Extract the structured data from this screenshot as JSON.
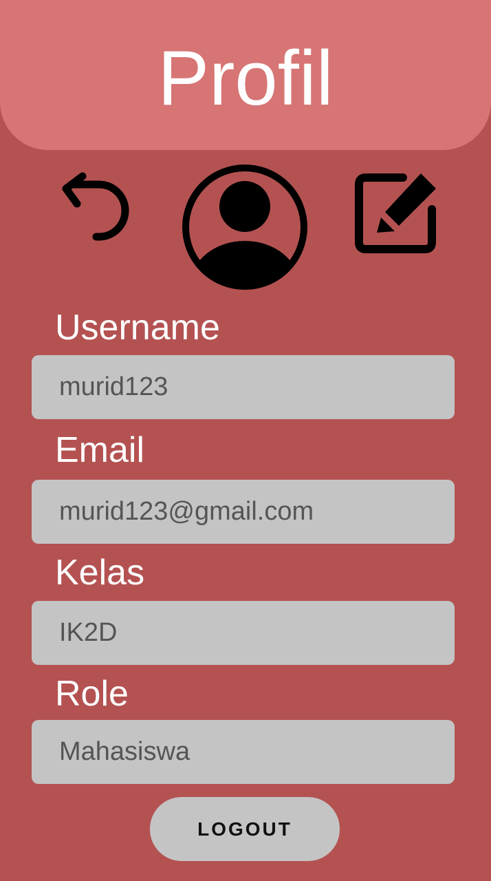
{
  "header": {
    "title": "Profil"
  },
  "toolbar": {
    "back_icon": "undo-arrow-icon",
    "avatar_icon": "account-circle-icon",
    "edit_icon": "edit-square-icon"
  },
  "fields": [
    {
      "label": "Username",
      "value": "murid123"
    },
    {
      "label": "Email",
      "value": "murid123@gmail.com"
    },
    {
      "label": "Kelas",
      "value": "IK2D"
    },
    {
      "label": "Role",
      "value": "Mahasiswa"
    }
  ],
  "logout_label": "LOGOUT",
  "colors": {
    "background": "#b45252",
    "header": "#d67574",
    "field": "#c4c4c4",
    "label_text": "#ffffff",
    "field_text": "#555555"
  }
}
